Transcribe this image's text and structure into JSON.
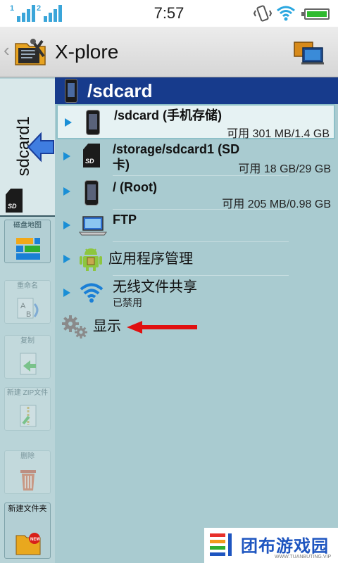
{
  "status_bar": {
    "sim1_label": "1",
    "sim2_label": "2",
    "time": "7:57"
  },
  "app": {
    "title": "X-plore"
  },
  "left_rail": {
    "tab_label": "sdcard1",
    "buttons": [
      {
        "label": "磁盘地图",
        "enabled": true
      },
      {
        "label": "重命名",
        "enabled": false
      },
      {
        "label": "复制",
        "enabled": false
      },
      {
        "label": "新建 ZIP文件",
        "enabled": false
      },
      {
        "label": "删除",
        "enabled": false
      },
      {
        "label": "新建文件夹",
        "enabled": true
      }
    ]
  },
  "path_header": "/sdcard",
  "items": [
    {
      "title": "/sdcard (手机存储)",
      "info": "可用 301 MB/1.4 GB",
      "icon": "phone-icon"
    },
    {
      "title": "/storage/sdcard1 (SD",
      "title2": "卡)",
      "info": "可用 18 GB/29 GB",
      "icon": "sd-card-icon"
    },
    {
      "title": "/ (Root)",
      "info": "可用 205 MB/0.98 GB",
      "icon": "phone-icon"
    },
    {
      "title": "FTP",
      "icon": "laptop-icon"
    },
    {
      "title": "应用程序管理",
      "icon": "android-icon"
    },
    {
      "title": "无线文件共享",
      "subtitle": "已禁用",
      "icon": "wifi-icon"
    },
    {
      "title": "显示",
      "icon": "gears-icon"
    }
  ],
  "watermark": {
    "text": "团布游戏园",
    "url": "WWW.TUANBUTING.VIP"
  },
  "colors": {
    "accent_blue": "#1a8fd6",
    "header_blue": "#173b8c",
    "annotation_red": "#e01010"
  }
}
